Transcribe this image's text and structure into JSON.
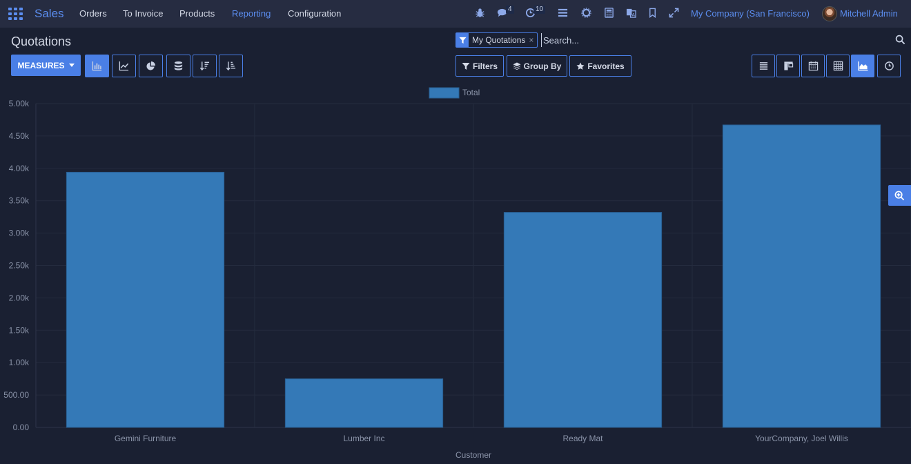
{
  "navbar": {
    "brand": "Sales",
    "menu": [
      {
        "label": "Orders",
        "active": false
      },
      {
        "label": "To Invoice",
        "active": false
      },
      {
        "label": "Products",
        "active": false
      },
      {
        "label": "Reporting",
        "active": true
      },
      {
        "label": "Configuration",
        "active": false
      }
    ],
    "messages_count": "4",
    "activities_count": "10",
    "company": "My Company (San Francisco)",
    "user": "Mitchell Admin"
  },
  "control_panel": {
    "title": "Quotations",
    "measures_label": "MEASURES",
    "search": {
      "facet": "My Quotations",
      "facet_close": "×",
      "placeholder": "Search..."
    },
    "filters_label": "Filters",
    "group_by_label": "Group By",
    "favorites_label": "Favorites"
  },
  "colors": {
    "accent": "#4a7fe6",
    "bar": "#3479b7",
    "background": "#1a2032",
    "navbar": "#262c41"
  },
  "chart_data": {
    "type": "bar",
    "categories": [
      "Gemini Furniture",
      "Lumber Inc",
      "Ready Mat",
      "YourCompany, Joel Willis"
    ],
    "series": [
      {
        "name": "Total",
        "values": [
          3940,
          750,
          3320,
          4670
        ]
      }
    ],
    "xlabel": "Customer",
    "ylabel": "",
    "ylim": [
      0,
      5000
    ],
    "yticks": [
      0,
      500,
      1000,
      1500,
      2000,
      2500,
      3000,
      3500,
      4000,
      4500,
      5000
    ],
    "ytick_labels": [
      "0.00",
      "500.00",
      "1.00k",
      "1.50k",
      "2.00k",
      "2.50k",
      "3.00k",
      "3.50k",
      "4.00k",
      "4.50k",
      "5.00k"
    ],
    "legend_position": "top-center",
    "grid": true
  }
}
